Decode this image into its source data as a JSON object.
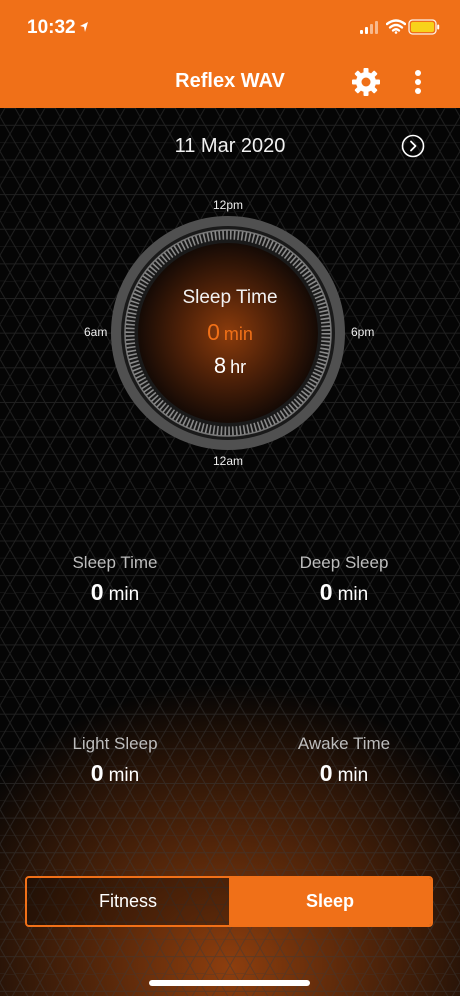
{
  "status_bar": {
    "time": "10:32"
  },
  "header": {
    "title": "Reflex WAV",
    "accent_color": "#f07018"
  },
  "date": {
    "label": "11 Mar 2020"
  },
  "dial": {
    "labels": {
      "top": "12pm",
      "bottom": "12am",
      "left": "6am",
      "right": "6pm"
    },
    "title": "Sleep Time",
    "minutes_value": "0",
    "minutes_unit": "min",
    "hours_value": "8",
    "hours_unit": "hr"
  },
  "stats": [
    {
      "label": "Sleep Time",
      "value": "0",
      "unit": "min"
    },
    {
      "label": "Deep Sleep",
      "value": "0",
      "unit": "min"
    },
    {
      "label": "Light Sleep",
      "value": "0",
      "unit": "min"
    },
    {
      "label": "Awake Time",
      "value": "0",
      "unit": "min"
    }
  ],
  "tabs": [
    {
      "label": "Fitness",
      "selected": false
    },
    {
      "label": "Sleep",
      "selected": true
    }
  ],
  "icons": [
    "location-arrow-icon",
    "signal-icon",
    "wifi-icon",
    "battery-icon",
    "gear-icon",
    "more-vertical-icon",
    "chevron-right-circle-icon"
  ]
}
